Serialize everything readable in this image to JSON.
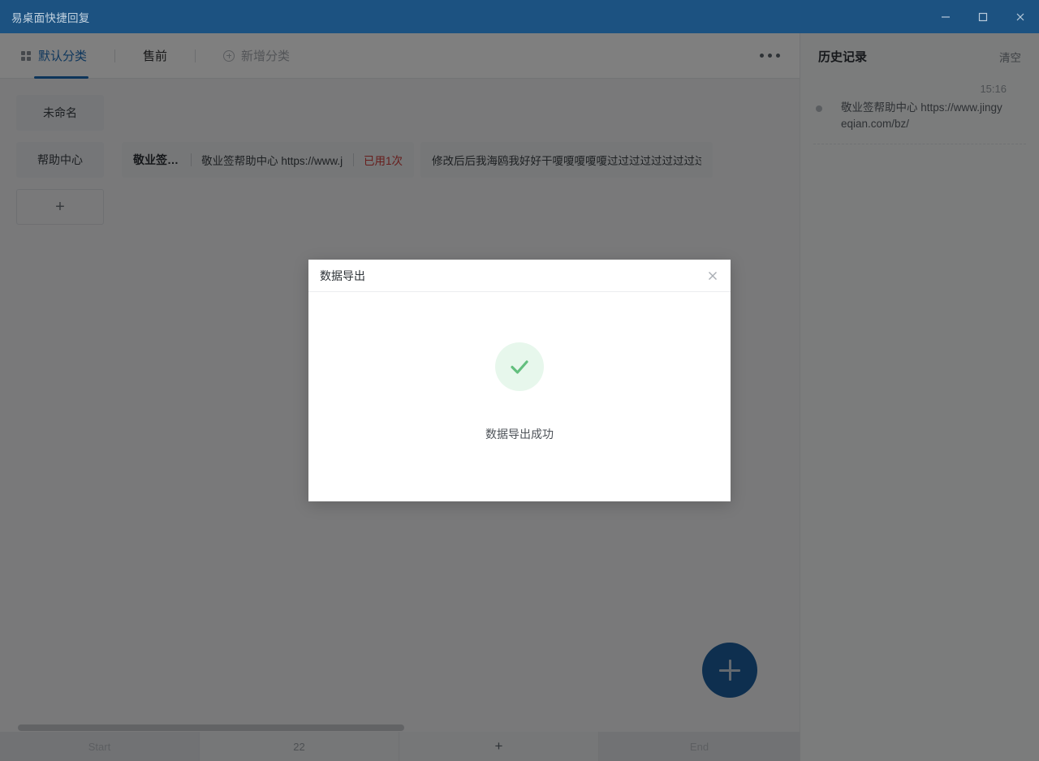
{
  "window": {
    "title": "易桌面快捷回复",
    "controls": {
      "minimize": "minimize-icon",
      "maximize": "maximize-icon",
      "close": "close-icon"
    }
  },
  "tabbar": {
    "tabs": [
      {
        "label": "默认分类",
        "active": true,
        "icon": "grid-icon"
      },
      {
        "label": "售前",
        "active": false,
        "icon": ""
      },
      {
        "label": "新增分类",
        "active": false,
        "icon": "plus-circle-icon",
        "muted": true
      }
    ],
    "more_menu": "more-options-icon"
  },
  "groups": [
    {
      "name": "未命名",
      "cards": []
    },
    {
      "name": "帮助中心",
      "cards": [
        {
          "title": "敬业签帮助中...",
          "content": "敬业签帮助中心 https://www.jingyeqian.com/bz/",
          "badge": "已用1次"
        },
        {
          "title": "",
          "content": "修改后后我海鸥我好好干嗄嗄嗄嗄嗄过过过过过过过过过过过过过过过过过过过",
          "badge": ""
        }
      ]
    }
  ],
  "add_group_label": "+",
  "fab": {
    "label": "+",
    "name": "add-item-fab",
    "color": "#1c5f9e"
  },
  "bottombar": {
    "start": "Start",
    "count": "22",
    "add": "+",
    "end": "End"
  },
  "history": {
    "title": "历史记录",
    "clear_label": "清空",
    "items": [
      {
        "time": "15:16",
        "text": "敬业签帮助中心 https://www.jingyeqian.com/bz/"
      }
    ]
  },
  "modal": {
    "title": "数据导出",
    "close_icon": "close-icon",
    "status_icon": "success-check-icon",
    "message": "数据导出成功"
  },
  "colors": {
    "titlebar": "#1c5281",
    "accent": "#1a6bb5",
    "badge_red": "#cf3b38",
    "success_green": "#63bf7e",
    "success_bg": "#e7f7ec",
    "fab": "#1c5f9e"
  }
}
